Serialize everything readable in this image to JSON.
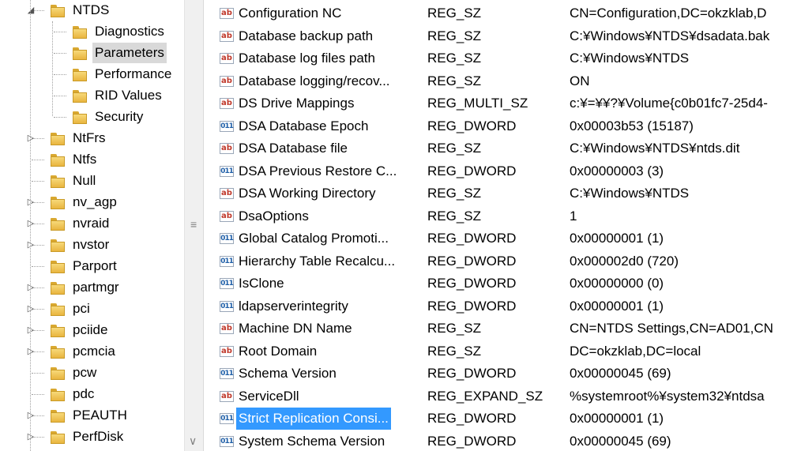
{
  "tree": {
    "items": [
      {
        "label": "NTDS",
        "expander": "◢",
        "level": 0
      },
      {
        "label": "Diagnostics",
        "expander": "",
        "level": 1
      },
      {
        "label": "Parameters",
        "expander": "",
        "level": 1
      },
      {
        "label": "Performance",
        "expander": "",
        "level": 1
      },
      {
        "label": "RID Values",
        "expander": "",
        "level": 1
      },
      {
        "label": "Security",
        "expander": "",
        "level": 1
      },
      {
        "label": "NtFrs",
        "expander": "▷",
        "level": 0
      },
      {
        "label": "Ntfs",
        "expander": "",
        "level": 0
      },
      {
        "label": "Null",
        "expander": "",
        "level": 0
      },
      {
        "label": "nv_agp",
        "expander": "▷",
        "level": 0
      },
      {
        "label": "nvraid",
        "expander": "▷",
        "level": 0
      },
      {
        "label": "nvstor",
        "expander": "▷",
        "level": 0
      },
      {
        "label": "Parport",
        "expander": "",
        "level": 0
      },
      {
        "label": "partmgr",
        "expander": "▷",
        "level": 0
      },
      {
        "label": "pci",
        "expander": "▷",
        "level": 0
      },
      {
        "label": "pciide",
        "expander": "▷",
        "level": 0
      },
      {
        "label": "pcmcia",
        "expander": "▷",
        "level": 0
      },
      {
        "label": "pcw",
        "expander": "",
        "level": 0
      },
      {
        "label": "pdc",
        "expander": "",
        "level": 0
      },
      {
        "label": "PEAUTH",
        "expander": "▷",
        "level": 0
      },
      {
        "label": "PerfDisk",
        "expander": "▷",
        "level": 0
      }
    ]
  },
  "values": {
    "rows": [
      {
        "icon": "ab",
        "name": "Configuration NC",
        "type": "REG_SZ",
        "data": "CN=Configuration,DC=okzklab,D"
      },
      {
        "icon": "ab",
        "name": "Database backup path",
        "type": "REG_SZ",
        "data": "C:¥Windows¥NTDS¥dsadata.bak"
      },
      {
        "icon": "ab",
        "name": "Database log files path",
        "type": "REG_SZ",
        "data": "C:¥Windows¥NTDS"
      },
      {
        "icon": "ab",
        "name": "Database logging/recov...",
        "type": "REG_SZ",
        "data": "ON"
      },
      {
        "icon": "ab",
        "name": "DS Drive Mappings",
        "type": "REG_MULTI_SZ",
        "data": "c:¥=¥¥?¥Volume{c0b01fc7-25d4-"
      },
      {
        "icon": "dw",
        "name": "DSA Database Epoch",
        "type": "REG_DWORD",
        "data": "0x00003b53 (15187)"
      },
      {
        "icon": "ab",
        "name": "DSA Database file",
        "type": "REG_SZ",
        "data": "C:¥Windows¥NTDS¥ntds.dit"
      },
      {
        "icon": "dw",
        "name": "DSA Previous Restore C...",
        "type": "REG_DWORD",
        "data": "0x00000003 (3)"
      },
      {
        "icon": "ab",
        "name": "DSA Working Directory",
        "type": "REG_SZ",
        "data": "C:¥Windows¥NTDS"
      },
      {
        "icon": "ab",
        "name": "DsaOptions",
        "type": "REG_SZ",
        "data": "1"
      },
      {
        "icon": "dw",
        "name": "Global Catalog Promoti...",
        "type": "REG_DWORD",
        "data": "0x00000001 (1)"
      },
      {
        "icon": "dw",
        "name": "Hierarchy Table Recalcu...",
        "type": "REG_DWORD",
        "data": "0x000002d0 (720)"
      },
      {
        "icon": "dw",
        "name": "IsClone",
        "type": "REG_DWORD",
        "data": "0x00000000 (0)"
      },
      {
        "icon": "dw",
        "name": "ldapserverintegrity",
        "type": "REG_DWORD",
        "data": "0x00000001 (1)"
      },
      {
        "icon": "ab",
        "name": "Machine DN Name",
        "type": "REG_SZ",
        "data": "CN=NTDS Settings,CN=AD01,CN"
      },
      {
        "icon": "ab",
        "name": "Root Domain",
        "type": "REG_SZ",
        "data": "DC=okzklab,DC=local"
      },
      {
        "icon": "dw",
        "name": "Schema Version",
        "type": "REG_DWORD",
        "data": "0x00000045 (69)"
      },
      {
        "icon": "ab",
        "name": "ServiceDll",
        "type": "REG_EXPAND_SZ",
        "data": "%systemroot%¥system32¥ntdsa"
      },
      {
        "icon": "dw",
        "name": "Strict Replication Consi...",
        "type": "REG_DWORD",
        "data": "0x00000001 (1)"
      },
      {
        "icon": "dw",
        "name": "System Schema Version",
        "type": "REG_DWORD",
        "data": "0x00000045 (69)"
      }
    ]
  },
  "icons": {
    "string_value": "ab",
    "dword_value": "011\n110"
  },
  "scrollbar": {
    "grip": "≡",
    "down": "∨"
  },
  "colors": {
    "selection": "#3399ff",
    "tree_selection": "#d9d9d9",
    "folder": "#f0c75a"
  }
}
